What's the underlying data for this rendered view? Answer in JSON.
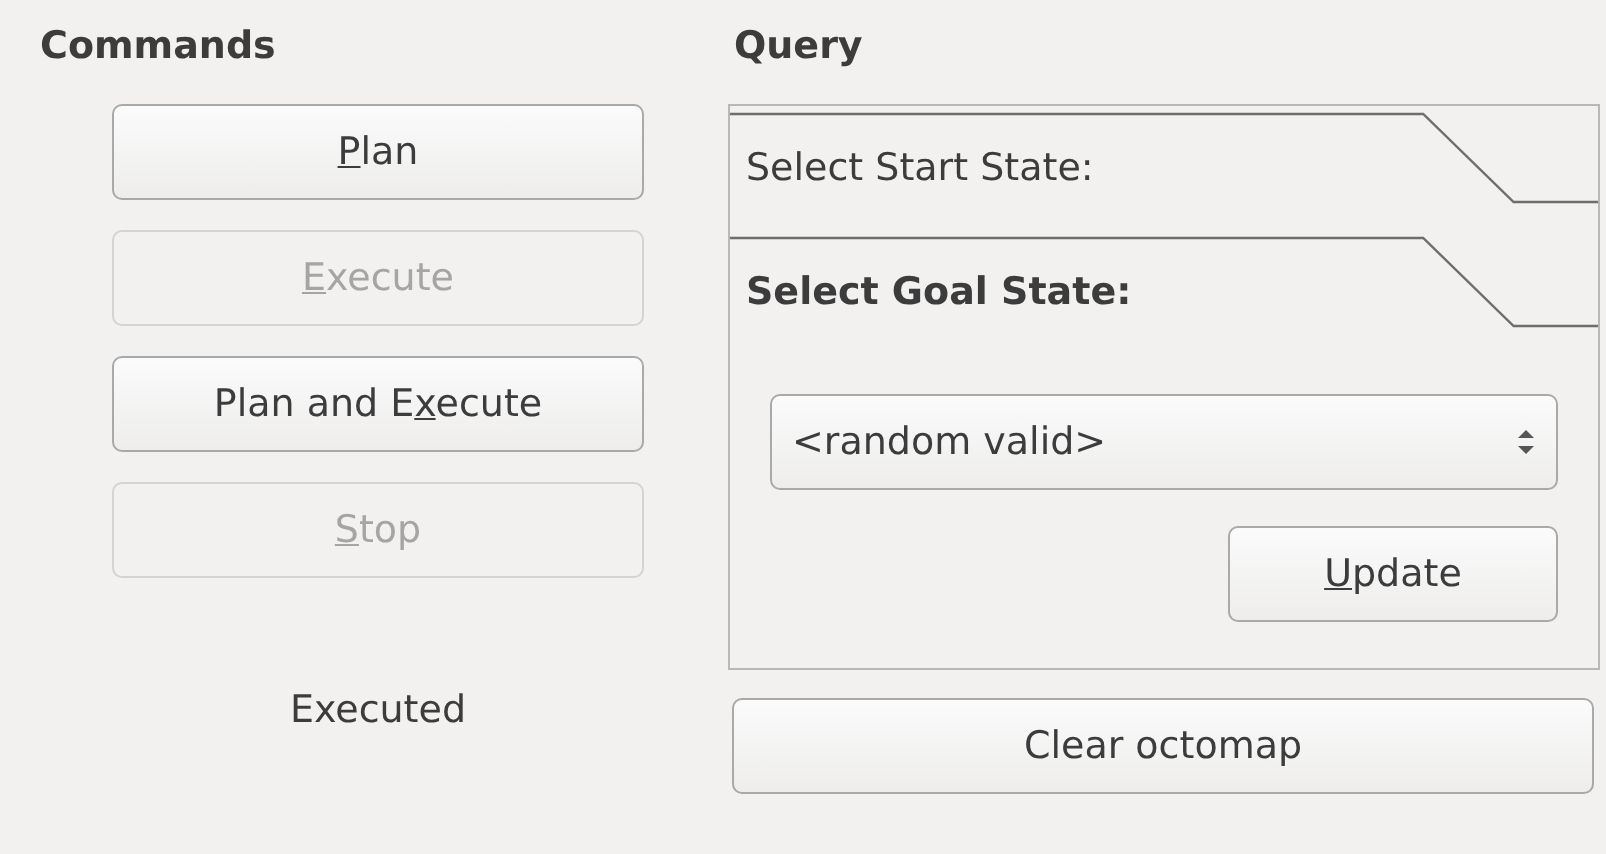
{
  "commands": {
    "heading": "Commands",
    "buttons": [
      {
        "label": {
          "key": "P",
          "after": "lan"
        },
        "disabled": false
      },
      {
        "label": {
          "key": "E",
          "after": "xecute"
        },
        "disabled": true
      },
      {
        "label": {
          "before": "Plan and E",
          "key": "x",
          "after": "ecute"
        },
        "disabled": false
      },
      {
        "label": {
          "key": "S",
          "after": "top"
        },
        "disabled": true
      }
    ],
    "status": "Executed"
  },
  "query": {
    "heading": "Query",
    "toolbox": [
      {
        "title": "Select Start State:",
        "selected": false
      },
      {
        "title": "Select Goal State:",
        "selected": true
      }
    ],
    "state_select": {
      "value": "<random valid>"
    },
    "update_button": {
      "label": {
        "key": "U",
        "after": "pdate"
      }
    },
    "clear_button": {
      "label": "Clear octomap"
    }
  }
}
